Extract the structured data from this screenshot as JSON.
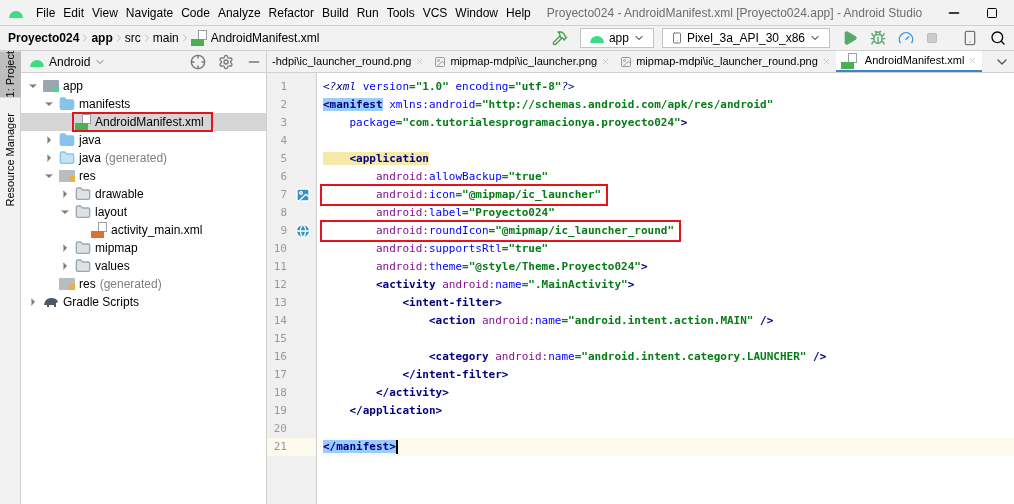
{
  "window": {
    "title": "Proyecto024 - AndroidManifest.xml [Proyecto024.app] - Android Studio"
  },
  "menu": [
    "File",
    "Edit",
    "View",
    "Navigate",
    "Code",
    "Analyze",
    "Refactor",
    "Build",
    "Run",
    "Tools",
    "VCS",
    "Window",
    "Help"
  ],
  "breadcrumbs": [
    {
      "label": "Proyecto024",
      "bold": true
    },
    {
      "label": "app",
      "bold": true
    },
    {
      "label": "src",
      "bold": false
    },
    {
      "label": "main",
      "bold": false
    },
    {
      "label": "AndroidManifest.xml",
      "bold": false
    }
  ],
  "run_config": "app",
  "device": "Pixel_3a_API_30_x86",
  "side_stripe": [
    {
      "label": "1: Project",
      "selected": true
    },
    {
      "label": "Resource Manager",
      "selected": false
    }
  ],
  "project_view": {
    "mode": "Android"
  },
  "tree": [
    {
      "label": "app",
      "kind": "module",
      "expanded": true,
      "selected": false,
      "highlighted": false,
      "children": [
        {
          "label": "manifests",
          "kind": "folder",
          "expanded": true,
          "selected": false,
          "highlighted": false,
          "children": [
            {
              "label": "AndroidManifest.xml",
              "kind": "manifest",
              "selected": true,
              "highlighted": true
            }
          ]
        },
        {
          "label": "java",
          "kind": "folder",
          "expanded": false,
          "selected": false,
          "highlighted": false
        },
        {
          "label": "java",
          "suffix": "(generated)",
          "kind": "folder-gen",
          "expanded": false,
          "selected": false,
          "highlighted": false
        },
        {
          "label": "res",
          "kind": "res",
          "expanded": true,
          "selected": false,
          "highlighted": false,
          "children": [
            {
              "label": "drawable",
              "kind": "dir",
              "expanded": false,
              "selected": false,
              "highlighted": false
            },
            {
              "label": "layout",
              "kind": "dir",
              "expanded": true,
              "selected": false,
              "highlighted": false,
              "children": [
                {
                  "label": "activity_main.xml",
                  "kind": "layout-file",
                  "selected": false,
                  "highlighted": false
                }
              ]
            },
            {
              "label": "mipmap",
              "kind": "dir",
              "expanded": false,
              "selected": false,
              "highlighted": false
            },
            {
              "label": "values",
              "kind": "dir",
              "expanded": false,
              "selected": false,
              "highlighted": false
            }
          ]
        },
        {
          "label": "res",
          "suffix": "(generated)",
          "kind": "res",
          "selected": false,
          "highlighted": false
        }
      ]
    },
    {
      "label": "Gradle Scripts",
      "kind": "gradle",
      "expanded": false,
      "selected": false,
      "highlighted": false
    }
  ],
  "tabs": [
    {
      "label": "-hdpi\\ic_launcher_round.png",
      "kind": "none",
      "selected": false
    },
    {
      "label": "mipmap-mdpi\\ic_launcher.png",
      "kind": "image",
      "selected": false
    },
    {
      "label": "mipmap-mdpi\\ic_launcher_round.png",
      "kind": "image",
      "selected": false
    },
    {
      "label": "AndroidManifest.xml",
      "kind": "manifest",
      "selected": true
    }
  ],
  "code": [
    {
      "n": "1",
      "tokens": [
        {
          "kind": "pi",
          "t": "<?xml "
        },
        {
          "kind": "attr",
          "t": "version"
        },
        {
          "kind": "str",
          "t": "=\"1.0\" "
        },
        {
          "kind": "attr",
          "t": "encoding"
        },
        {
          "kind": "str",
          "t": "=\"utf-8\""
        },
        {
          "kind": "pi",
          "t": "?>"
        }
      ]
    },
    {
      "n": "2",
      "tokens": [
        {
          "kind": "match",
          "t": "<manifest"
        },
        {
          "kind": "attr",
          "t": " xmlns:android"
        },
        {
          "kind": "str",
          "t": "=\"http://schemas.android.com/apk/res/android\""
        }
      ]
    },
    {
      "n": "3",
      "tokens": [
        {
          "kind": "attr",
          "t": "    package"
        },
        {
          "kind": "str",
          "t": "=\"com.tutorialesprogramacionya.proyecto024\""
        },
        {
          "kind": "tag",
          "t": ">"
        }
      ]
    },
    {
      "n": "4"
    },
    {
      "n": "5",
      "tokens": [
        {
          "kind": "tagmark",
          "t": "    <application"
        }
      ]
    },
    {
      "n": "6",
      "tokens": [
        {
          "kind": "ns",
          "t": "        android:"
        },
        {
          "kind": "attr",
          "t": "allowBackup"
        },
        {
          "kind": "str",
          "t": "=\"true\""
        }
      ]
    },
    {
      "n": "7",
      "gutter_icon": {
        "kind": "image"
      },
      "highlighted": true,
      "tokens": [
        {
          "kind": "ns",
          "t": "        android:"
        },
        {
          "kind": "attr",
          "t": "icon"
        },
        {
          "kind": "str",
          "t": "=\"@mipmap/ic_launcher\""
        }
      ]
    },
    {
      "n": "8",
      "tokens": [
        {
          "kind": "ns",
          "t": "        android:"
        },
        {
          "kind": "attr",
          "t": "label"
        },
        {
          "kind": "str",
          "t": "=\"Proyecto024\""
        }
      ]
    },
    {
      "n": "9",
      "gutter_icon": {
        "kind": "globe"
      },
      "highlighted": true,
      "tokens": [
        {
          "kind": "ns",
          "t": "        android:"
        },
        {
          "kind": "attr",
          "t": "roundIcon"
        },
        {
          "kind": "str",
          "t": "=\"@mipmap/ic_launcher_round\""
        }
      ]
    },
    {
      "n": "10",
      "tokens": [
        {
          "kind": "ns",
          "t": "        android:"
        },
        {
          "kind": "attr",
          "t": "supportsRtl"
        },
        {
          "kind": "str",
          "t": "=\"true\""
        }
      ]
    },
    {
      "n": "11",
      "tokens": [
        {
          "kind": "ns",
          "t": "        android:"
        },
        {
          "kind": "attr",
          "t": "theme"
        },
        {
          "kind": "str",
          "t": "=\"@style/Theme.Proyecto024\""
        },
        {
          "kind": "tag",
          "t": ">"
        }
      ]
    },
    {
      "n": "12",
      "tokens": [
        {
          "kind": "tag",
          "t": "        <activity "
        },
        {
          "kind": "ns",
          "t": "android:"
        },
        {
          "kind": "attr",
          "t": "name"
        },
        {
          "kind": "str",
          "t": "=\".MainActivity\""
        },
        {
          "kind": "tag",
          "t": ">"
        }
      ]
    },
    {
      "n": "13",
      "tokens": [
        {
          "kind": "tag",
          "t": "            <intent-filter>"
        }
      ]
    },
    {
      "n": "14",
      "tokens": [
        {
          "kind": "tag",
          "t": "                <action "
        },
        {
          "kind": "ns",
          "t": "android:"
        },
        {
          "kind": "attr",
          "t": "name"
        },
        {
          "kind": "str",
          "t": "=\"android.intent.action.MAIN\""
        },
        {
          "kind": "tag",
          "t": " />"
        }
      ]
    },
    {
      "n": "15"
    },
    {
      "n": "16",
      "tokens": [
        {
          "kind": "tag",
          "t": "                <category "
        },
        {
          "kind": "ns",
          "t": "android:"
        },
        {
          "kind": "attr",
          "t": "name"
        },
        {
          "kind": "str",
          "t": "=\"android.intent.category.LAUNCHER\""
        },
        {
          "kind": "tag",
          "t": " />"
        }
      ]
    },
    {
      "n": "17",
      "tokens": [
        {
          "kind": "tag",
          "t": "            </intent-filter>"
        }
      ]
    },
    {
      "n": "18",
      "tokens": [
        {
          "kind": "tag",
          "t": "        </activity>"
        }
      ]
    },
    {
      "n": "19",
      "tokens": [
        {
          "kind": "tag",
          "t": "    </application>"
        }
      ]
    },
    {
      "n": "20"
    },
    {
      "n": "21",
      "current": true,
      "tokens": [
        {
          "kind": "match",
          "t": "</manifest>"
        }
      ]
    }
  ]
}
